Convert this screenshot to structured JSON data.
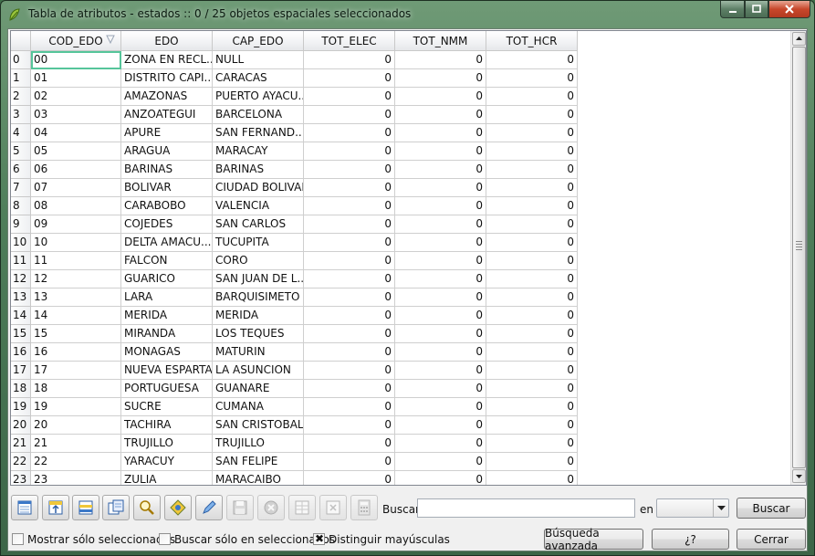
{
  "window": {
    "title": "Tabla de atributos - estados :: 0 / 25 objetos espaciales seleccionados"
  },
  "table": {
    "columns": [
      "COD_EDO",
      "EDO",
      "CAP_EDO",
      "TOT_ELEC",
      "TOT_NMM",
      "TOT_HCR"
    ],
    "rows": [
      [
        "0",
        "00",
        "ZONA EN RECL...",
        "NULL",
        "0",
        "0",
        "0"
      ],
      [
        "1",
        "01",
        "DISTRITO CAPI...",
        "CARACAS",
        "0",
        "0",
        "0"
      ],
      [
        "2",
        "02",
        "AMAZONAS",
        "PUERTO AYACU...",
        "0",
        "0",
        "0"
      ],
      [
        "3",
        "03",
        "ANZOATEGUI",
        "BARCELONA",
        "0",
        "0",
        "0"
      ],
      [
        "4",
        "04",
        "APURE",
        "SAN FERNAND...",
        "0",
        "0",
        "0"
      ],
      [
        "5",
        "05",
        "ARAGUA",
        "MARACAY",
        "0",
        "0",
        "0"
      ],
      [
        "6",
        "06",
        "BARINAS",
        "BARINAS",
        "0",
        "0",
        "0"
      ],
      [
        "7",
        "07",
        "BOLIVAR",
        "CIUDAD BOLIVAR",
        "0",
        "0",
        "0"
      ],
      [
        "8",
        "08",
        "CARABOBO",
        "VALENCIA",
        "0",
        "0",
        "0"
      ],
      [
        "9",
        "09",
        "COJEDES",
        "SAN CARLOS",
        "0",
        "0",
        "0"
      ],
      [
        "10",
        "10",
        "DELTA AMACU...",
        "TUCUPITA",
        "0",
        "0",
        "0"
      ],
      [
        "11",
        "11",
        "FALCON",
        "CORO",
        "0",
        "0",
        "0"
      ],
      [
        "12",
        "12",
        "GUARICO",
        "SAN JUAN DE L...",
        "0",
        "0",
        "0"
      ],
      [
        "13",
        "13",
        "LARA",
        "BARQUISIMETO",
        "0",
        "0",
        "0"
      ],
      [
        "14",
        "14",
        "MERIDA",
        "MERIDA",
        "0",
        "0",
        "0"
      ],
      [
        "15",
        "15",
        "MIRANDA",
        "LOS TEQUES",
        "0",
        "0",
        "0"
      ],
      [
        "16",
        "16",
        "MONAGAS",
        "MATURIN",
        "0",
        "0",
        "0"
      ],
      [
        "17",
        "17",
        "NUEVA ESPARTA",
        "LA ASUNCION",
        "0",
        "0",
        "0"
      ],
      [
        "18",
        "18",
        "PORTUGUESA",
        "GUANARE",
        "0",
        "0",
        "0"
      ],
      [
        "19",
        "19",
        "SUCRE",
        "CUMANA",
        "0",
        "0",
        "0"
      ],
      [
        "20",
        "20",
        "TACHIRA",
        "SAN CRISTOBAL",
        "0",
        "0",
        "0"
      ],
      [
        "21",
        "21",
        "TRUJILLO",
        "TRUJILLO",
        "0",
        "0",
        "0"
      ],
      [
        "22",
        "22",
        "YARACUY",
        "SAN FELIPE",
        "0",
        "0",
        "0"
      ],
      [
        "23",
        "23",
        "ZULIA",
        "MARACAIBO",
        "0",
        "0",
        "0"
      ]
    ]
  },
  "toolbar": {
    "icons": [
      {
        "name": "unselect-all-icon",
        "disabled": false
      },
      {
        "name": "move-selection-to-top-icon",
        "disabled": false
      },
      {
        "name": "invert-selection-icon",
        "disabled": false
      },
      {
        "name": "copy-selected-rows-icon",
        "disabled": false
      },
      {
        "name": "zoom-to-selection-icon",
        "disabled": false
      },
      {
        "name": "pan-to-selection-icon",
        "disabled": false
      },
      {
        "name": "toggle-editing-icon",
        "disabled": false
      },
      {
        "name": "save-edits-icon",
        "disabled": true
      },
      {
        "name": "delete-selected-icon",
        "disabled": true
      },
      {
        "name": "new-column-icon",
        "disabled": true
      },
      {
        "name": "delete-column-icon",
        "disabled": true
      },
      {
        "name": "field-calculator-icon",
        "disabled": true
      }
    ],
    "search_label": "Buscar",
    "search_value": "",
    "in_label": "en",
    "field_selected": "",
    "search_button": "Buscar"
  },
  "footer": {
    "show_selected_only": {
      "label": "Mostrar sólo seleccionados",
      "checked": false
    },
    "search_selected_only": {
      "label": "Buscar sólo en seleccionados",
      "checked": false
    },
    "case_sensitive": {
      "label": "Distinguir mayúsculas",
      "checked": true
    },
    "advanced_search_button": "Búsqueda avanzada",
    "help_button": "¿?",
    "close_button": "Cerrar"
  },
  "colors": {
    "selected_cell_outline": "#56c59a",
    "close_button": "#c7472b"
  }
}
